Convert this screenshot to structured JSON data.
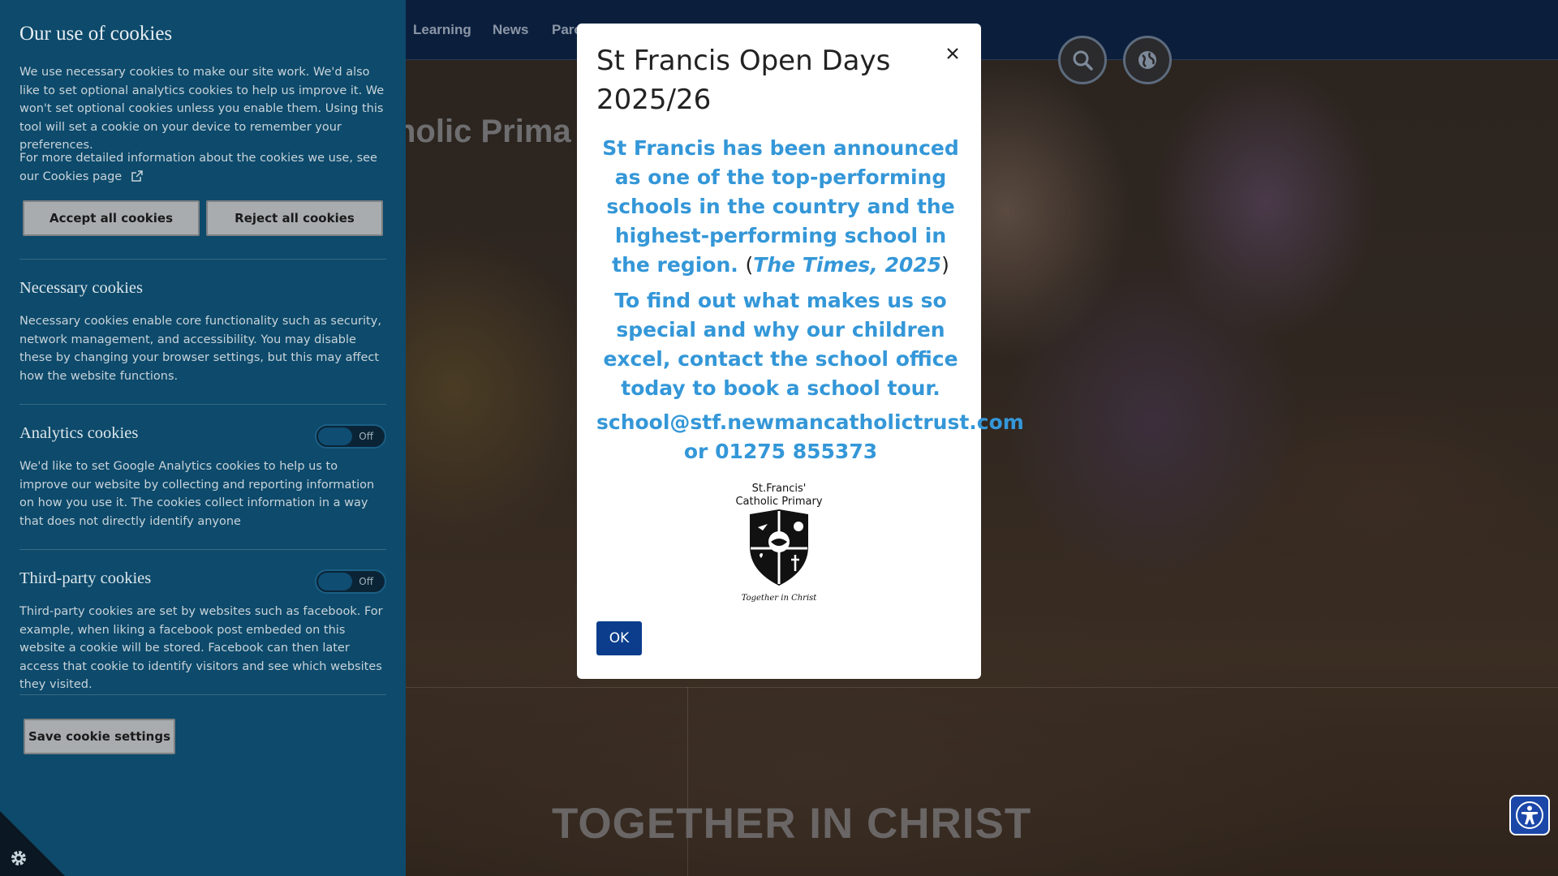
{
  "site": {
    "nav": [
      "Learning",
      "News",
      "Pare"
    ],
    "hero_title": "holic Prima",
    "motto": "TOGETHER IN CHRIST",
    "icons": {
      "search": "search-icon",
      "translate": "globe-icon",
      "accessibility": "accessibility-icon"
    }
  },
  "cookies": {
    "title": "Our use of cookies",
    "intro": "We use necessary cookies to make our site work. We'd also like to set optional analytics cookies to help us improve it. We won't set optional cookies unless you enable them. Using this tool will set a cookie on your device to remember your preferences.",
    "more_info": "For more detailed information about the cookies we use, see our Cookies page",
    "accept_label": "Accept all cookies",
    "reject_label": "Reject all cookies",
    "necessary_heading": "Necessary cookies",
    "necessary_text": "Necessary cookies enable core functionality such as security, network management, and accessibility. You may disable these by changing your browser settings, but this may affect how the website functions.",
    "analytics_heading": "Analytics cookies",
    "analytics_toggle": "Off",
    "analytics_text": "We'd like to set Google Analytics cookies to help us to improve our website by collecting and reporting information on how you use it. The cookies collect information in a way that does not directly identify anyone",
    "thirdparty_heading": "Third-party cookies",
    "thirdparty_toggle": "Off",
    "thirdparty_text": "Third-party cookies are set by websites such as facebook. For example, when liking a facebook post embeded on this website a cookie will be stored. Facebook can then later access that cookie to identify visitors and see which websites they visited.",
    "save_label": "Save cookie settings"
  },
  "modal": {
    "title": "St Francis Open Days 2025/26",
    "p1": "St Francis has been announced as one of the top-performing schools in the country and the highest-performing school in the region.",
    "p1_open": "(",
    "p1_cite": "The Times, 2025",
    "p1_close": ")",
    "p2": "To find out what makes us so special and why our children excel, contact the school office today to book a school tour.",
    "email": "school@stf.newmancatholictrust.com",
    "phone": "or 01275 855373",
    "logo_line1": "St.Francis'",
    "logo_line2": "Catholic Primary",
    "logo_motto": "Together in Christ",
    "ok_label": "OK"
  },
  "colors": {
    "cookie_panel": "#0d4a6b",
    "modal_text": "#3497d8",
    "ok_button": "#0b3d8c",
    "nav_bg": "#0b1f3d"
  }
}
